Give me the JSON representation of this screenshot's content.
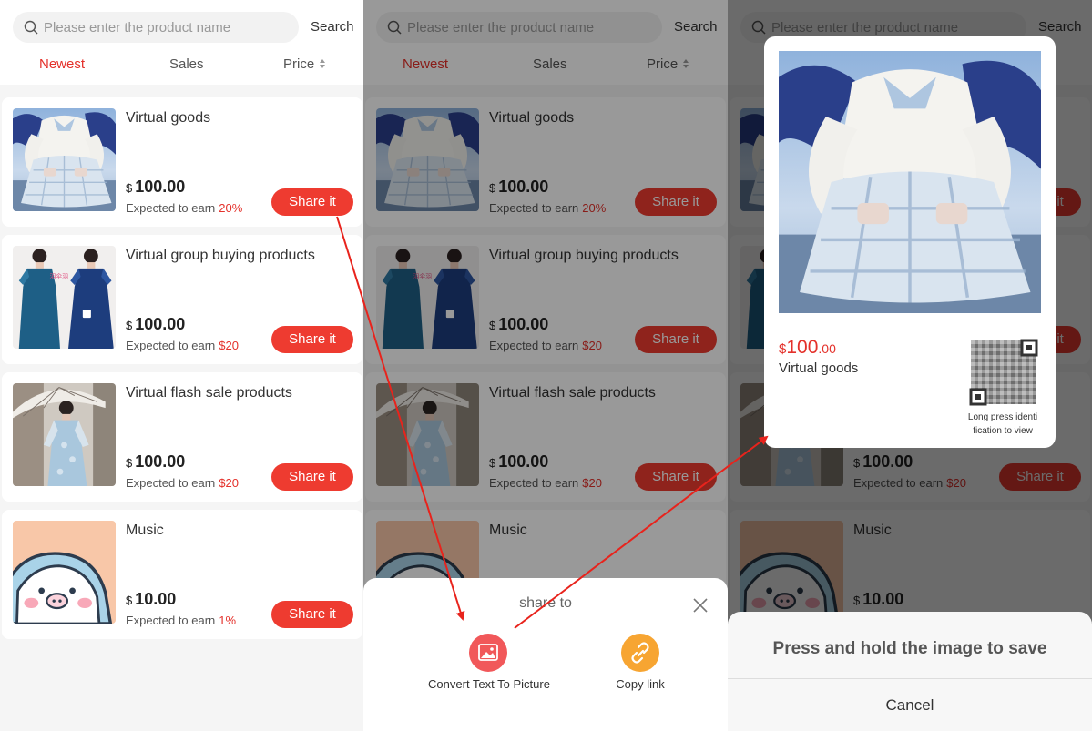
{
  "search": {
    "placeholder": "Please enter the product name",
    "button_label": "Search"
  },
  "sort_tabs": {
    "newest": "Newest",
    "sales": "Sales",
    "price": "Price"
  },
  "products": [
    {
      "name": "Virtual goods",
      "currency": "$",
      "price": "100.00",
      "earn_label": "Expected to earn",
      "earn_rate": "20%",
      "share_label": "Share it"
    },
    {
      "name": "Virtual group buying products",
      "currency": "$",
      "price": "100.00",
      "earn_label": "Expected to earn",
      "earn_rate": "$20",
      "share_label": "Share it"
    },
    {
      "name": "Virtual flash sale products",
      "currency": "$",
      "price": "100.00",
      "earn_label": "Expected to earn",
      "earn_rate": "$20",
      "share_label": "Share it"
    },
    {
      "name": "Music",
      "currency": "$",
      "price": "10.00",
      "earn_label": "Expected to earn",
      "earn_rate": "1%",
      "share_label": "Share it"
    }
  ],
  "share_sheet": {
    "title": "share to",
    "convert_label": "Convert Text To Picture",
    "copy_label": "Copy link"
  },
  "poster": {
    "currency": "$",
    "price_int": "100",
    "price_cents": ".00",
    "name": "Virtual goods",
    "qr_caption_line1": "Long press identi",
    "qr_caption_line2": "fication to view"
  },
  "save_sheet": {
    "title": "Press and hold the image to save",
    "cancel_label": "Cancel"
  },
  "colors": {
    "accent": "#e4312b",
    "share_button": "#ee3b30",
    "convert_icon_bg": "#f1585a",
    "copy_icon_bg": "#f7a532"
  },
  "icons": [
    "search-icon",
    "sort-arrows-icon",
    "close-icon",
    "picture-icon",
    "link-icon",
    "qr-code-icon",
    "arrow-icon"
  ]
}
